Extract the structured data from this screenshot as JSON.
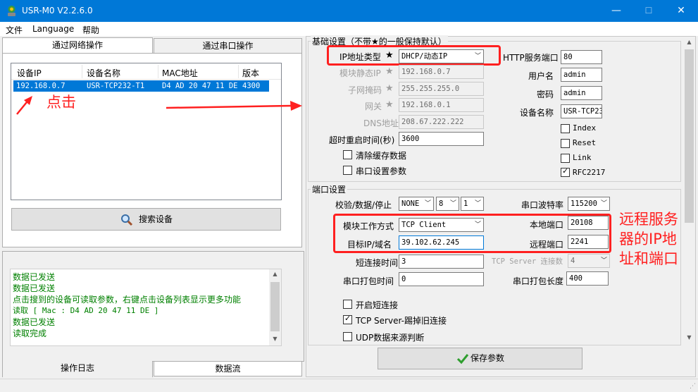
{
  "window": {
    "title": "USR-M0 V2.2.6.0",
    "minimize": "—",
    "maximize": "☐",
    "close": "✕"
  },
  "menu": [
    "文件",
    "Language",
    "帮助"
  ],
  "left_tabs": {
    "network": "通过网络操作",
    "serial": "通过串口操作"
  },
  "device_table": {
    "headers": [
      "设备IP",
      "设备名称",
      "MAC地址",
      "版本"
    ],
    "rows": [
      [
        "192.168.0.7",
        "USR-TCP232-T1",
        "D4 AD 20 47 11 DE",
        "4300"
      ]
    ]
  },
  "annotations": {
    "click": "点击",
    "remote": "远程服务器的IP地址和端口"
  },
  "search_button": "搜索设备",
  "log_lines": [
    "数据已发送",
    "数据已发送",
    "点击搜到的设备可读取参数，右键点击设备列表显示更多功能",
    "读取 [ Mac : D4 AD 20 47 11 DE ]",
    "数据已发送",
    "读取完成"
  ],
  "bottom_tabs": {
    "log": "操作日志",
    "stream": "数据流"
  },
  "basic": {
    "title": "基础设置（不带★的一般保持默认）",
    "ip_type_label": "IP地址类型",
    "ip_type_value": "DHCP/动态IP",
    "static_ip_label": "模块静态IP",
    "static_ip": "192.168.0.7",
    "mask_label": "子网掩码",
    "mask": "255.255.255.0",
    "gateway_label": "网关",
    "gateway": "192.168.0.1",
    "dns_label": "DNS地址",
    "dns": "208.67.222.222",
    "timeout_label": "超时重启时间(秒)",
    "timeout": "3600",
    "clear_cache": "清除缓存数据",
    "serial_params": "串口设置参数",
    "http_port_label": "HTTP服务端口",
    "http_port": "80",
    "username_label": "用户名",
    "username": "admin",
    "password_label": "密码",
    "password": "admin",
    "devname_label": "设备名称",
    "devname": "USR-TCP23",
    "chk_index": "Index",
    "chk_reset": "Reset",
    "chk_link": "Link",
    "chk_rfc": "RFC2217"
  },
  "port": {
    "title": "端口设置",
    "parity_label": "校验/数据/停止",
    "parity": "NONE",
    "databits": "8",
    "stopbits": "1",
    "baud_label": "串口波特率",
    "baud": "115200",
    "mode_label": "模块工作方式",
    "mode": "TCP Client",
    "local_port_label": "本地端口",
    "local_port": "20108",
    "target_label": "目标IP/域名",
    "target": "39.102.62.245",
    "remote_port_label": "远程端口",
    "remote_port": "2241",
    "short_label": "短连接时间",
    "short": "3",
    "tcp_server_label": "TCP Server 连接数",
    "tcp_server": "4",
    "pack_time_label": "串口打包时间",
    "pack_time": "0",
    "pack_len_label": "串口打包长度",
    "pack_len": "400",
    "chk_short": "开启短连接",
    "chk_kick": "TCP Server-踢掉旧连接",
    "chk_udp": "UDP数据来源判断"
  },
  "save_button": "保存参数",
  "colors": {
    "titlebar": "#0078d7",
    "selection": "#0078d7",
    "annotation": "#ff2020",
    "log": "#008000"
  }
}
